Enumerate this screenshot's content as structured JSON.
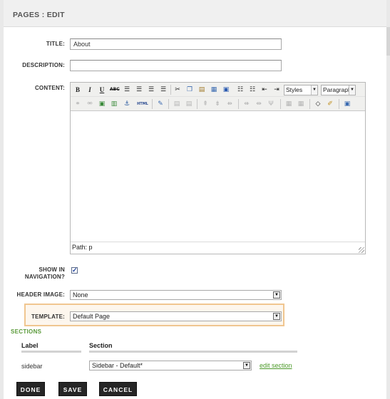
{
  "header": {
    "title": "PAGES : EDIT"
  },
  "form": {
    "title_label": "TITLE:",
    "title_value": "About",
    "description_label": "DESCRIPTION:",
    "description_value": "",
    "content_label": "CONTENT:",
    "show_nav_label_1": "SHOW IN",
    "show_nav_label_2": "NAVIGATION?",
    "show_nav_checked": true,
    "header_image_label": "HEADER IMAGE:",
    "header_image_value": "None",
    "template_label": "TEMPLATE:",
    "template_value": "Default Page"
  },
  "editor": {
    "row1": [
      "bold-icon",
      "italic-icon",
      "underline-icon",
      "strikethrough-icon",
      "align-left-icon",
      "align-center-icon",
      "align-right-icon",
      "align-justify-icon",
      "cut-icon",
      "copy-icon",
      "paste-icon",
      "paste-text-icon",
      "paste-word-icon",
      "bullet-list-icon",
      "numbered-list-icon",
      "outdent-icon",
      "indent-icon"
    ],
    "styles_value": "Styles",
    "format_value": "Paragraph",
    "row2": [
      "link-icon",
      "unlink-icon",
      "image-icon",
      "media-icon",
      "anchor-icon",
      "html-source-icon",
      "edit-icon",
      "table-icon",
      "table-props-icon",
      "row-insert-icon",
      "row-delete-icon",
      "col-insert-icon",
      "col-delete-icon",
      "split-cells-icon",
      "merge-cells-icon",
      "eraser-icon",
      "cleanup-icon",
      "template-icon"
    ],
    "path_text": "Path: p"
  },
  "sections": {
    "heading": "SECTIONS",
    "col_label": "Label",
    "col_section": "Section",
    "rows": [
      {
        "label": "sidebar",
        "section": "Sidebar - Default*",
        "action": "edit section"
      }
    ]
  },
  "actions": {
    "done": "DONE",
    "save": "SAVE",
    "cancel": "CANCEL"
  },
  "colors": {
    "accent_green": "#4c9a2a",
    "template_highlight": "#f0c690",
    "button_bg": "#262626"
  }
}
